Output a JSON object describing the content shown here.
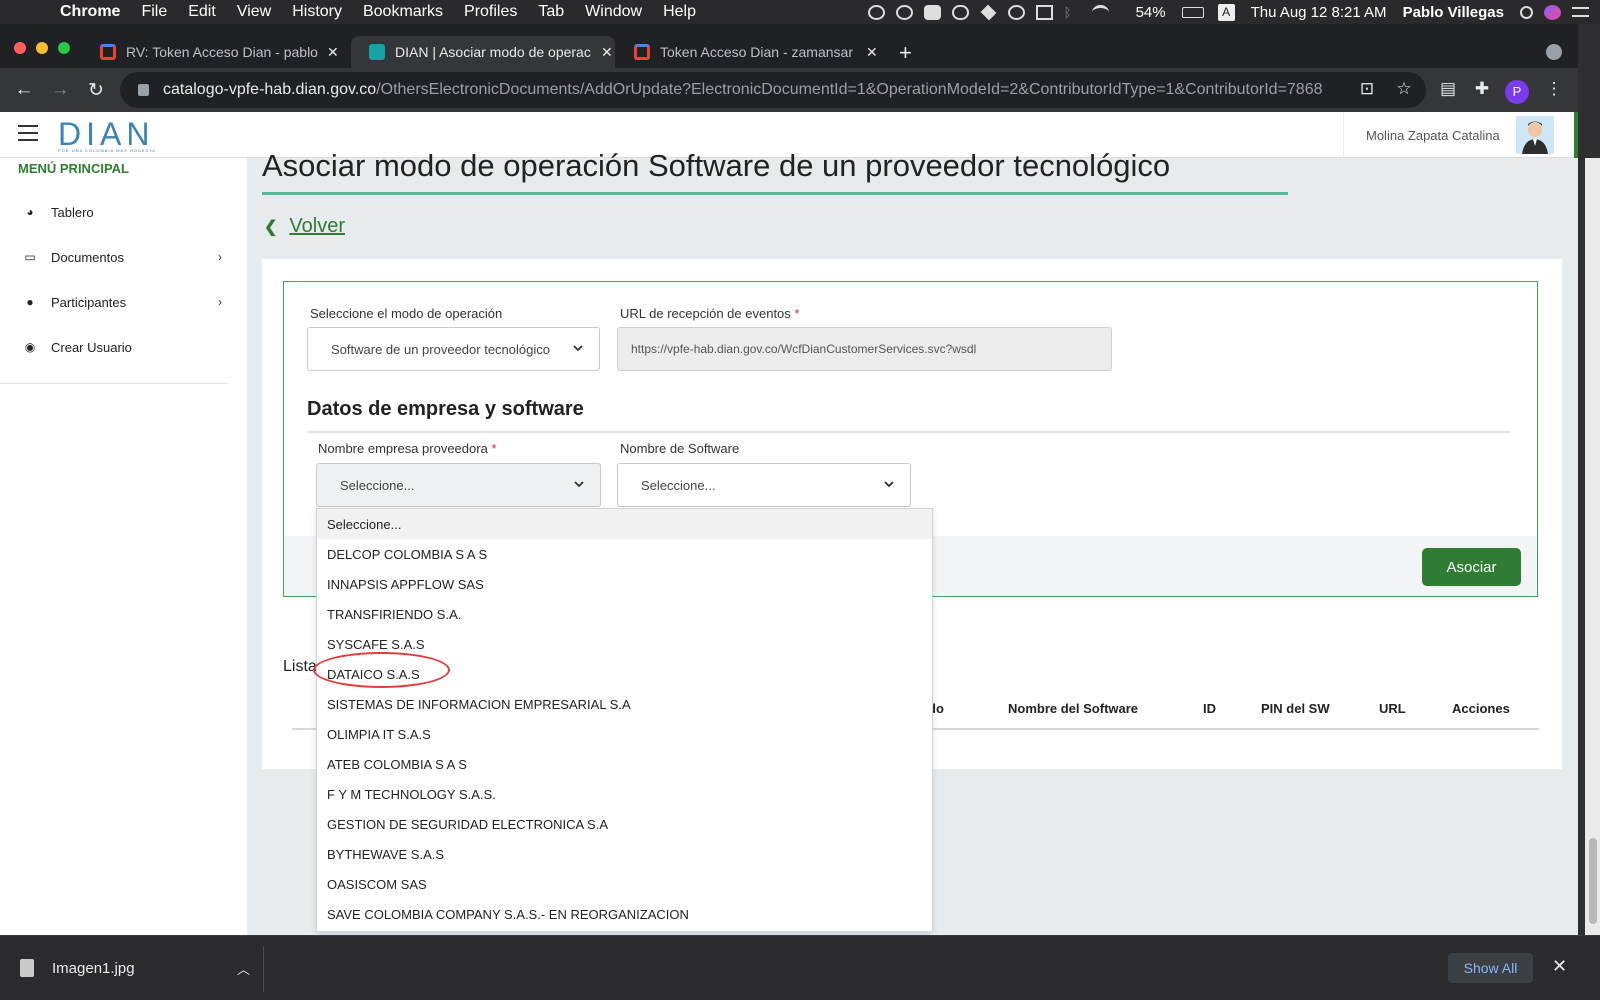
{
  "mac_menu": {
    "apple": "",
    "items": [
      "Chrome",
      "File",
      "Edit",
      "View",
      "History",
      "Bookmarks",
      "Profiles",
      "Tab",
      "Window",
      "Help"
    ],
    "battery": "54%",
    "input_source": "A",
    "datetime": "Thu Aug 12  8:21 AM",
    "user": "Pablo Villegas"
  },
  "tabs": [
    {
      "title": "RV: Token Acceso Dian - pablo",
      "favicon_color": "#ea4335"
    },
    {
      "title": "DIAN | Asociar modo de operac",
      "favicon_color": "#16a3a3"
    },
    {
      "title": "Token Acceso Dian - zamansar",
      "favicon_color": "#ea4335"
    }
  ],
  "url": {
    "host": "catalogo-vpfe-hab.dian.gov.co",
    "path": "/OthersElectronicDocuments/AddOrUpdate?ElectronicDocumentId=1&OperationModeId=2&ContributorIdType=1&ContributorId=7868"
  },
  "profile_initial": "P",
  "header": {
    "logo_text": "DIAN",
    "logo_tagline": "POR UNA COLOMBIA MÁS HONESTA",
    "user_name": "Molina Zapata Catalina"
  },
  "sidebar": {
    "title": "MENÚ PRINCIPAL",
    "items": [
      {
        "label": "Tablero",
        "icon": "dashboard-icon",
        "has_submenu": false
      },
      {
        "label": "Documentos",
        "icon": "inbox-icon",
        "has_submenu": true
      },
      {
        "label": "Participantes",
        "icon": "users-icon",
        "has_submenu": true
      },
      {
        "label": "Crear Usuario",
        "icon": "user-circle-icon",
        "has_submenu": false
      }
    ]
  },
  "page": {
    "title": "Asociar modo de operación Software de un proveedor tecnológico",
    "back_label": "Volver"
  },
  "form": {
    "mode_label": "Seleccione el modo de operación",
    "mode_value": "Software de un proveedor tecnológico",
    "url_label": "URL de recepción de eventos",
    "url_required": "*",
    "url_value": "https://vpfe-hab.dian.gov.co/WcfDianCustomerServices.svc?wsdl",
    "section_title": "Datos de empresa y software",
    "company_label": "Nombre empresa proveedora",
    "company_required": "*",
    "company_value": "Seleccione...",
    "software_label": "Nombre de Software",
    "software_value": "Seleccione...",
    "submit_label": "Asociar"
  },
  "dropdown": {
    "options": [
      "Seleccione...",
      "DELCOP COLOMBIA S A S",
      "INNAPSIS APPFLOW SAS",
      "TRANSFIRIENDO S.A.",
      "SYSCAFE S.A.S",
      "DATAICO S.A.S",
      "SISTEMAS DE INFORMACION EMPRESARIAL S.A",
      "OLIMPIA IT S.A.S",
      "ATEB COLOMBIA S A S",
      "F Y M TECHNOLOGY S.A.S.",
      "GESTION DE SEGURIDAD ELECTRONICA S.A",
      "BYTHEWAVE S.A.S",
      "OASISCOM SAS",
      "SAVE COLOMBIA COMPANY S.A.S.- EN REORGANIZACION"
    ],
    "highlighted_option": "DATAICO S.A.S",
    "highlight_color": "#e53935"
  },
  "list": {
    "label": "Lista",
    "columns": [
      "do",
      "Nombre del Software",
      "ID",
      "PIN del SW",
      "URL",
      "Acciones"
    ]
  },
  "downloads": {
    "file_name": "Imagen1.jpg",
    "show_all_label": "Show All"
  },
  "colors": {
    "brand_green": "#2e7d32",
    "dian_blue": "#3b82b6",
    "title_underline": "#58b795"
  }
}
